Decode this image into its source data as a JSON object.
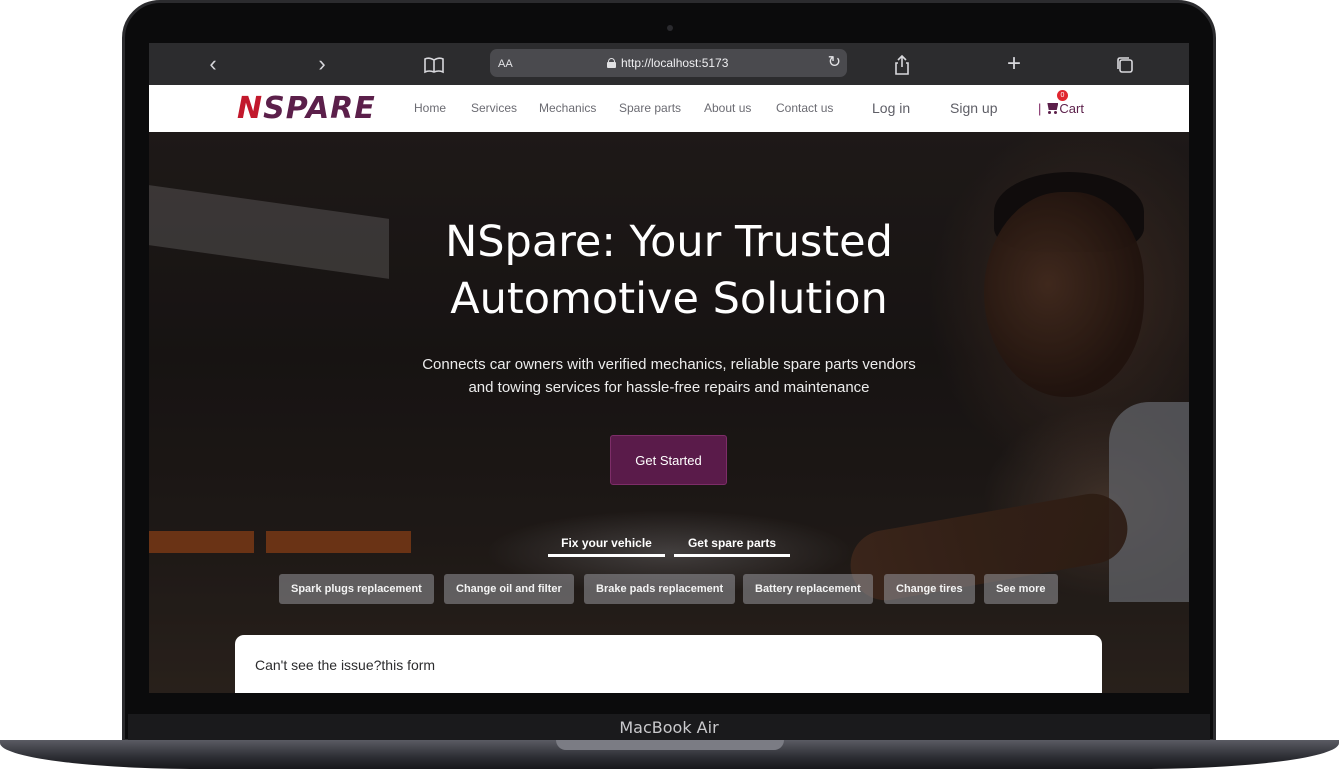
{
  "device": {
    "label": "MacBook Air"
  },
  "browser": {
    "text_size_label": "AA",
    "url": "http://localhost:5173"
  },
  "site": {
    "logo": {
      "accent": "N",
      "rest": "SPARE"
    },
    "nav": [
      "Home",
      "Services",
      "Mechanics",
      "Spare parts",
      "About us",
      "Contact us"
    ],
    "login_label": "Log in",
    "signup_label": "Sign up",
    "cart_label": "Cart",
    "cart_count": "0",
    "colors": {
      "brand": "#5a1b4a",
      "accent": "#c2182c"
    }
  },
  "hero": {
    "title_line1": "NSpare: Your Trusted",
    "title_line2": "Automotive Solution",
    "subtitle_line1": "Connects car owners with verified mechanics, reliable spare parts vendors",
    "subtitle_line2": "and towing services for hassle-free repairs and maintenance",
    "cta_label": "Get Started",
    "tabs": [
      "Fix your vehicle",
      "Get spare parts"
    ],
    "services": [
      "Spark plugs replacement",
      "Change oil and filter",
      "Brake pads replacement",
      "Battery replacement",
      "Change tires",
      "See more"
    ]
  },
  "issue_card": {
    "text": "Can't see the issue?this form"
  }
}
